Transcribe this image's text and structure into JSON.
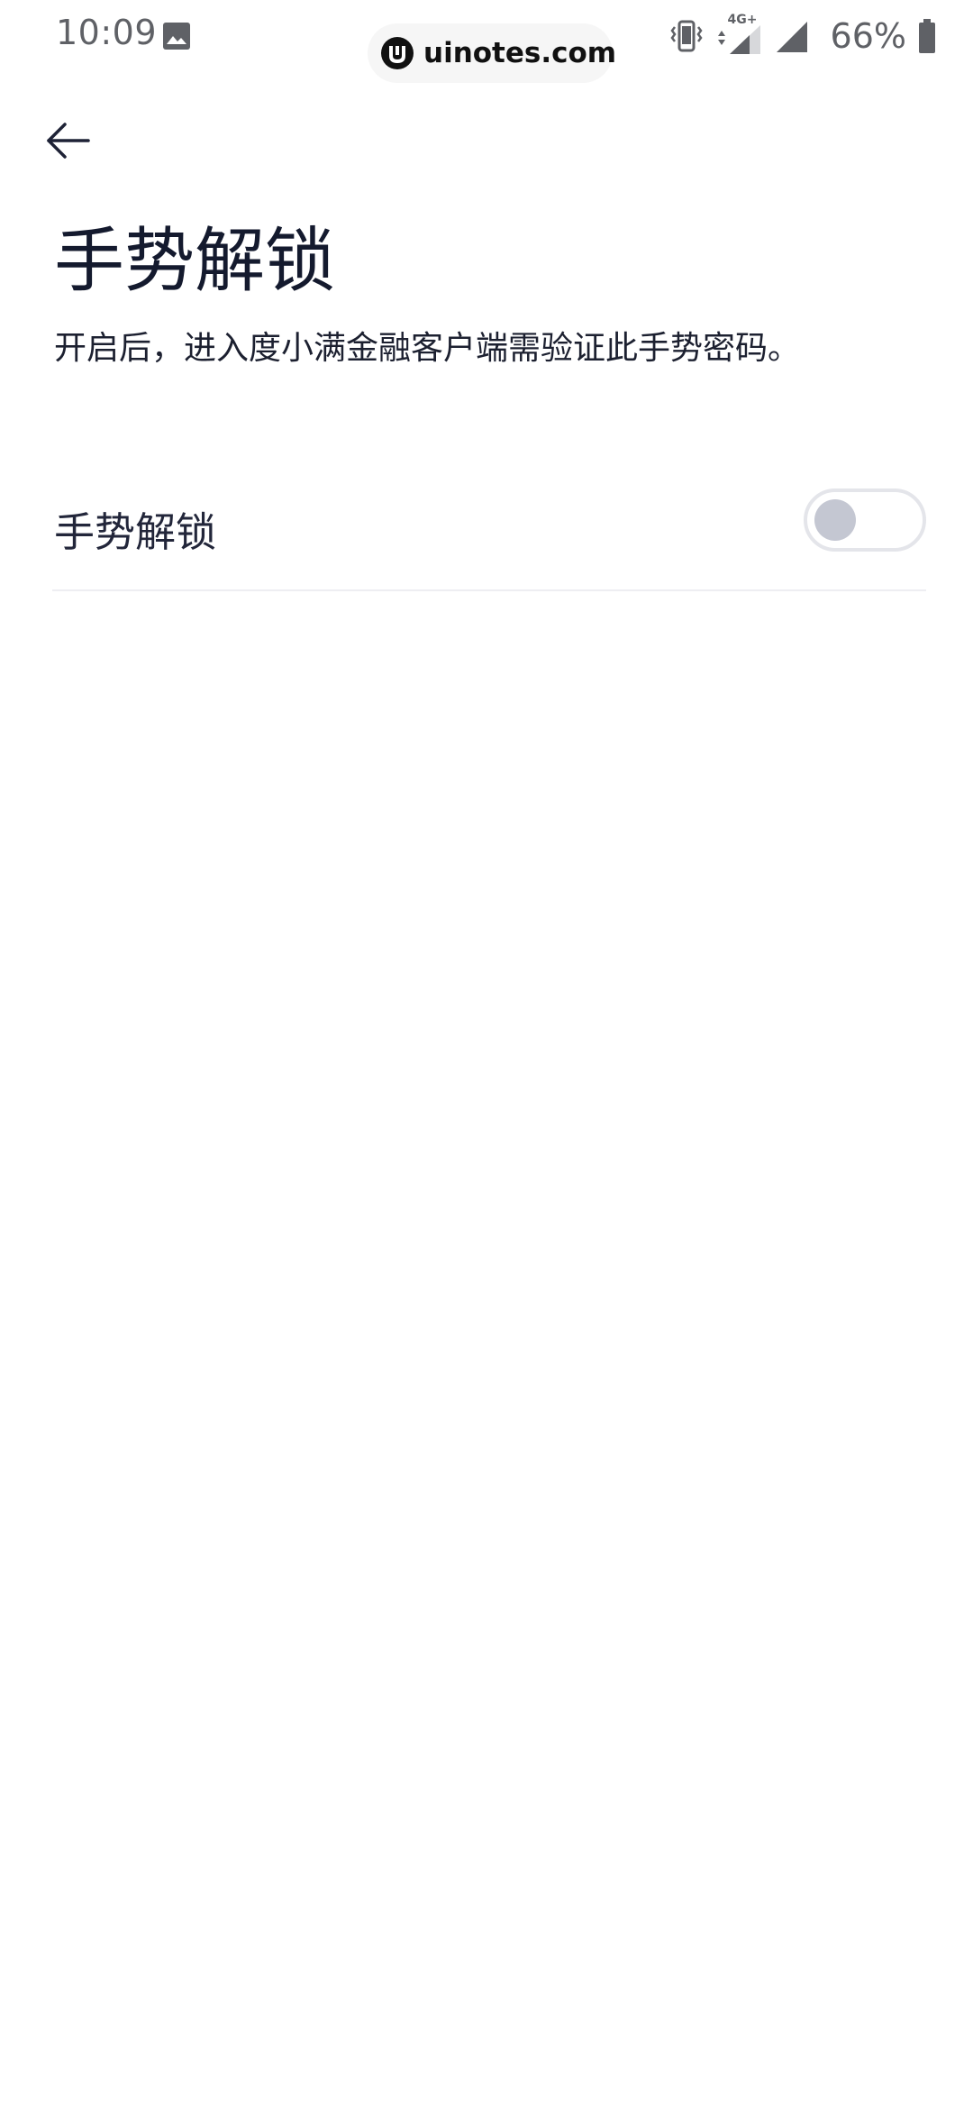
{
  "status_bar": {
    "time": "10:09",
    "network_label": "4G+",
    "battery_percent": "66%",
    "icons": [
      "photo-icon",
      "vibrate-icon",
      "data-arrows-icon",
      "signal-icon",
      "signal-icon",
      "battery-icon"
    ]
  },
  "watermark": {
    "text": "uinotes.com"
  },
  "header": {
    "back_icon": "arrow-left-icon",
    "title": "手势解锁",
    "subtitle": "开启后，进入度小满金融客户端需验证此手势密码。"
  },
  "settings": {
    "items": [
      {
        "label": "手势解锁",
        "enabled": false
      }
    ]
  },
  "colors": {
    "text_primary": "#141a2e",
    "toggle_border": "#e4e5ea",
    "toggle_knob_off": "#c4c7d2",
    "divider": "#eeeef2"
  }
}
